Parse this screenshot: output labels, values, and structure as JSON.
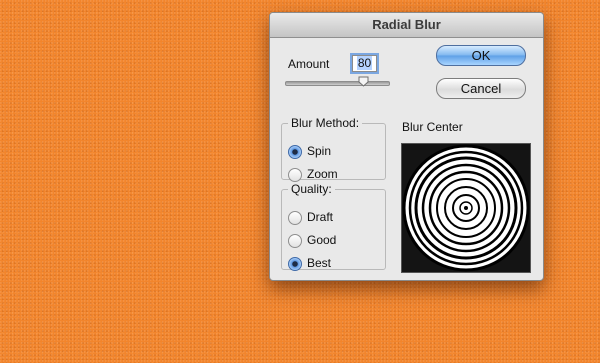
{
  "dialog": {
    "title": "Radial Blur",
    "amount": {
      "label": "Amount",
      "value": "80",
      "slider_fraction": 0.8
    },
    "buttons": {
      "ok": "OK",
      "cancel": "Cancel"
    },
    "blur_method": {
      "legend": "Blur Method:",
      "options": [
        "Spin",
        "Zoom"
      ],
      "selected": "Spin"
    },
    "quality": {
      "legend": "Quality:",
      "options": [
        "Draft",
        "Good",
        "Best"
      ],
      "selected": "Best"
    },
    "blur_center": {
      "label": "Blur Center"
    }
  },
  "colors": {
    "background": "#f2852c",
    "dialog": "#e9e9e9",
    "ok_button": "#6aa8ea"
  }
}
